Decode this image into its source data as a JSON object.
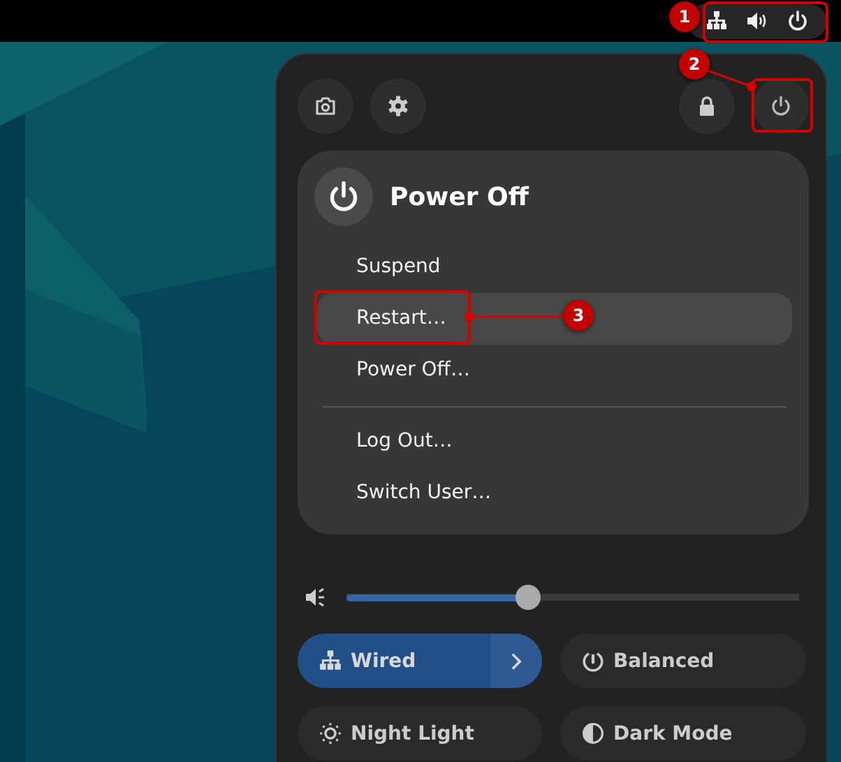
{
  "annotations": [
    {
      "label": "1"
    },
    {
      "label": "2"
    },
    {
      "label": "3"
    }
  ],
  "power_menu": {
    "title": "Power Off",
    "sections": [
      {
        "items": [
          {
            "label": "Suspend",
            "selected": false
          },
          {
            "label": "Restart…",
            "selected": true
          },
          {
            "label": "Power Off…",
            "selected": false
          }
        ]
      },
      {
        "items": [
          {
            "label": "Log Out…",
            "selected": false
          },
          {
            "label": "Switch User…",
            "selected": false
          }
        ]
      }
    ]
  },
  "volume": {
    "level": 0.4
  },
  "toggles": [
    {
      "label": "Wired",
      "on": true,
      "has_menu": true
    },
    {
      "label": "Balanced",
      "on": false,
      "has_menu": false
    },
    {
      "label": "Night Light",
      "on": false,
      "has_menu": false
    },
    {
      "label": "Dark Mode",
      "on": false,
      "has_menu": false
    }
  ]
}
